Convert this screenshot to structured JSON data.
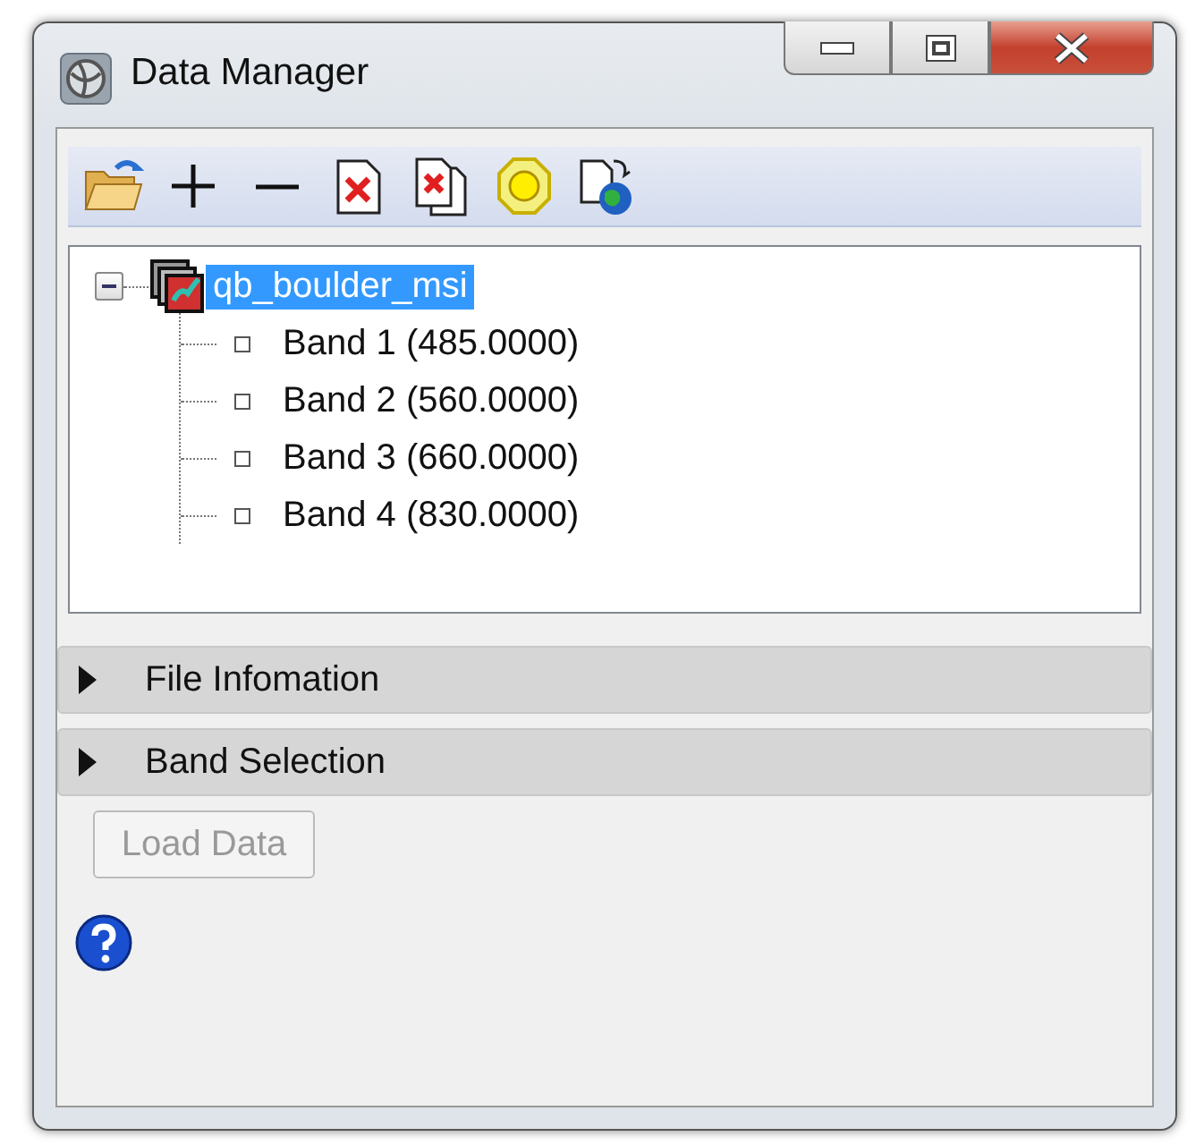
{
  "window": {
    "title": "Data Manager"
  },
  "toolbar": {
    "buttons": [
      {
        "kind": "open"
      },
      {
        "kind": "add"
      },
      {
        "kind": "remove"
      },
      {
        "kind": "close-file"
      },
      {
        "kind": "close-all"
      },
      {
        "kind": "stop"
      },
      {
        "kind": "remote"
      }
    ]
  },
  "tree": [
    {
      "label": "qb_boulder_msi",
      "selected": true,
      "expanded": true,
      "children": [
        {
          "label": "Band 1 (485.0000)",
          "checked": false
        },
        {
          "label": "Band 2 (560.0000)",
          "checked": false
        },
        {
          "label": "Band 3 (660.0000)",
          "checked": false
        },
        {
          "label": "Band 4 (830.0000)",
          "checked": false
        }
      ]
    }
  ],
  "sections": [
    {
      "label": "File Infomation",
      "expanded": false
    },
    {
      "label": "Band Selection",
      "expanded": false
    }
  ],
  "load_button": {
    "label": "Load Data",
    "disabled": true
  }
}
